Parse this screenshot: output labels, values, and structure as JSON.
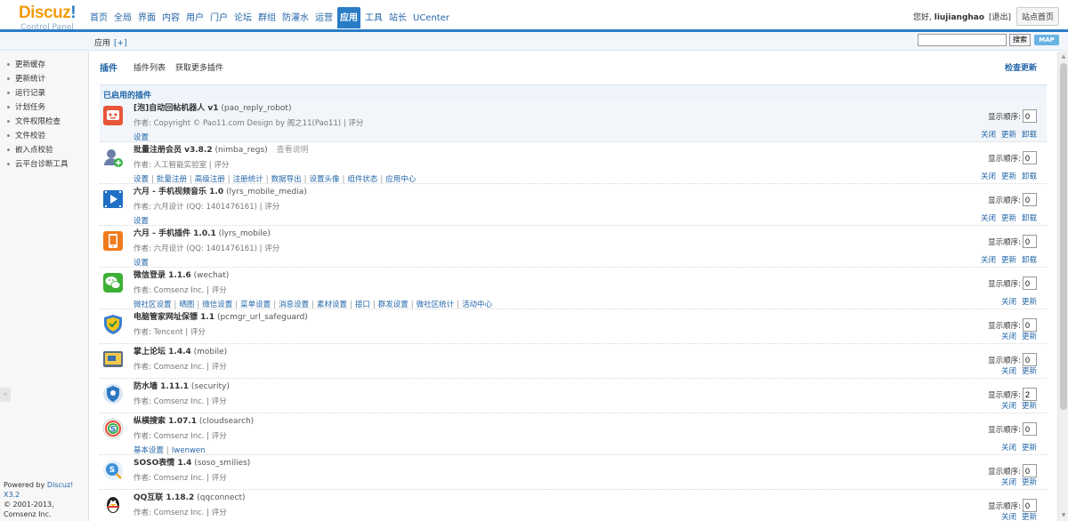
{
  "logo": {
    "brand": "Discuz",
    "brand_ex": "!",
    "subtitle": "Control Panel"
  },
  "nav": [
    {
      "label": "首页"
    },
    {
      "label": "全局"
    },
    {
      "label": "界面"
    },
    {
      "label": "内容"
    },
    {
      "label": "用户"
    },
    {
      "label": "门户"
    },
    {
      "label": "论坛"
    },
    {
      "label": "群组"
    },
    {
      "label": "防灌水"
    },
    {
      "label": "运营"
    },
    {
      "label": "应用",
      "active": true
    },
    {
      "label": "工具"
    },
    {
      "label": "站长"
    },
    {
      "label": "UCenter"
    }
  ],
  "topbar": {
    "greeting": "您好,",
    "username": "liujianghao",
    "logout": "[退出]",
    "site_home": "站点首页"
  },
  "subbar": {
    "crumb": "应用",
    "add": "[+]",
    "search_placeholder": "",
    "search_button": "搜索",
    "map_button": "MAP"
  },
  "sidebar": {
    "items": [
      {
        "label": "更新缓存"
      },
      {
        "label": "更新统计"
      },
      {
        "label": "运行记录"
      },
      {
        "label": "计划任务"
      },
      {
        "label": "文件权限检查"
      },
      {
        "label": "文件校验"
      },
      {
        "label": "嵌入点校验"
      },
      {
        "label": "云平台诊断工具"
      }
    ],
    "collapse": "«",
    "footer_powered": "Powered by ",
    "footer_version": "Discuz! X3.2",
    "footer_copy": "© 2001-2013, Comsenz Inc."
  },
  "main": {
    "title": "插件",
    "tabs": [
      {
        "label": "插件列表"
      },
      {
        "label": "获取更多插件"
      }
    ],
    "check_update": "检查更新",
    "section_title": "已启用的插件",
    "order_label": "显示顺序:",
    "plugins": [
      {
        "name": "[泡]自动回帖机器人 v1",
        "id": "(pao_reply_robot)",
        "readme": "",
        "author": "作者: Copyright © Pao11.com Design by 阁之11(Pao11) | 评分",
        "links": [
          "设置"
        ],
        "order": "0",
        "actions": [
          "关闭",
          "更新",
          "卸载"
        ],
        "icon": "robot-icon",
        "icon_color": "#e8553a",
        "highlight": true
      },
      {
        "name": "批量注册会员 v3.8.2",
        "id": "(nimba_regs)",
        "readme": "查看说明",
        "author": "作者: 人工智能实验室 | 评分",
        "links": [
          "设置",
          "批量注册",
          "高级注册",
          "注册统计",
          "数据导出",
          "设置头像",
          "组件状态",
          "应用中心"
        ],
        "order": "0",
        "actions": [
          "关闭",
          "更新",
          "卸载"
        ],
        "icon": "users-add-icon",
        "icon_color": "#6b7fa8",
        "highlight": false
      },
      {
        "name": "六月 - 手机视频音乐 1.0",
        "id": "(lyrs_mobile_media)",
        "readme": "",
        "author": "作者: 六月设计 (QQ: 1401476161) | 评分",
        "links": [
          "设置"
        ],
        "order": "0",
        "actions": [
          "关闭",
          "更新",
          "卸载"
        ],
        "icon": "video-play-icon",
        "icon_color": "#1f6fc4",
        "highlight": false
      },
      {
        "name": "六月 - 手机插件 1.0.1",
        "id": "(lyrs_mobile)",
        "readme": "",
        "author": "作者: 六月设计 (QQ: 1401476161) | 评分",
        "links": [
          "设置"
        ],
        "order": "0",
        "actions": [
          "关闭",
          "更新",
          "卸载"
        ],
        "icon": "mobile-phone-icon",
        "icon_color": "#f07b1c",
        "highlight": false
      },
      {
        "name": "微信登录 1.1.6",
        "id": "(wechat)",
        "readme": "",
        "author": "作者: Comsenz Inc. | 评分",
        "links": [
          "微社区设置",
          "晒图",
          "微信设置",
          "菜单设置",
          "消息设置",
          "素材设置",
          "接口",
          "群发设置",
          "微社区统计",
          "活动中心"
        ],
        "order": "0",
        "actions": [
          "关闭",
          "更新"
        ],
        "icon": "wechat-icon",
        "icon_color": "#3cb034",
        "highlight": false
      },
      {
        "name": "电脑管家网址保镖 1.1",
        "id": "(pcmgr_url_safeguard)",
        "readme": "",
        "author": "作者: Tencent | 评分",
        "links": [],
        "order": "0",
        "actions": [
          "关闭",
          "更新"
        ],
        "icon": "shield-icon",
        "icon_color": "#3a7fd0",
        "highlight": false
      },
      {
        "name": "掌上论坛 1.4.4",
        "id": "(mobile)",
        "readme": "",
        "author": "作者: Comsenz Inc. | 评分",
        "links": [],
        "order": "0",
        "actions": [
          "关闭",
          "更新"
        ],
        "icon": "tablet-icon",
        "icon_color": "#5a6d86",
        "highlight": false
      },
      {
        "name": "防水墙 1.11.1",
        "id": "(security)",
        "readme": "",
        "author": "作者: Comsenz Inc. | 评分",
        "links": [],
        "order": "2",
        "actions": [
          "关闭",
          "更新"
        ],
        "icon": "security-icon",
        "icon_color": "#2d78c2",
        "highlight": false
      },
      {
        "name": "纵横搜索 1.07.1",
        "id": "(cloudsearch)",
        "readme": "",
        "author": "作者: Comsenz Inc. | 评分",
        "links": [
          "基本设置",
          "Iwenwen"
        ],
        "order": "0",
        "actions": [
          "关闭",
          "更新"
        ],
        "icon": "search-s-icon",
        "icon_color": "#e8a81c",
        "highlight": false
      },
      {
        "name": "SOSO表情 1.4",
        "id": "(soso_smilies)",
        "readme": "",
        "author": "作者: Comsenz Inc. | 评分",
        "links": [],
        "order": "0",
        "actions": [
          "关闭",
          "更新"
        ],
        "icon": "soso-icon",
        "icon_color": "#3b8fd8",
        "highlight": false
      },
      {
        "name": "QQ互联 1.18.2",
        "id": "(qqconnect)",
        "readme": "",
        "author": "作者: Comsenz Inc. | 评分",
        "links": [],
        "order": "0",
        "actions": [
          "关闭",
          "更新"
        ],
        "icon": "qq-penguin-icon",
        "icon_color": "#222222",
        "highlight": false
      }
    ]
  }
}
